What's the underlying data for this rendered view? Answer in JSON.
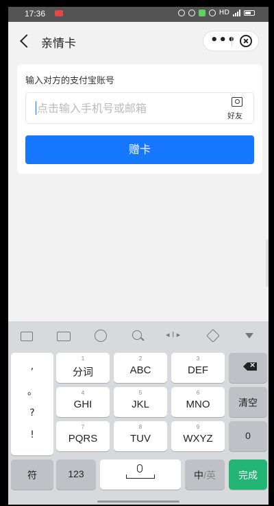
{
  "status_bar": {
    "time": "17:36",
    "network": "HD"
  },
  "nav": {
    "title": "亲情卡",
    "more_label": "•••"
  },
  "form": {
    "label": "输入对方的支付宝账号",
    "placeholder": "点击输入手机号或邮箱",
    "friend_label": "好友",
    "submit_label": "赠卡"
  },
  "keyboard": {
    "punct": [
      ",",
      "。",
      "?",
      "!"
    ],
    "row1": [
      {
        "num": "1",
        "label": "分词"
      },
      {
        "num": "2",
        "label": "ABC"
      },
      {
        "num": "3",
        "label": "DEF"
      }
    ],
    "row2": [
      {
        "num": "4",
        "label": "GHI"
      },
      {
        "num": "5",
        "label": "JKL"
      },
      {
        "num": "6",
        "label": "MNO"
      }
    ],
    "row3": [
      {
        "num": "7",
        "label": "PQRS"
      },
      {
        "num": "8",
        "label": "TUV"
      },
      {
        "num": "9",
        "label": "WXYZ"
      }
    ],
    "clear": "清空",
    "zero": "0",
    "symbols": "符",
    "numbers": "123",
    "lang_zh": "中",
    "lang_sep": "/",
    "lang_en": "英",
    "done": "完成"
  },
  "colors": {
    "primary": "#1677ff",
    "done": "#22b573"
  }
}
